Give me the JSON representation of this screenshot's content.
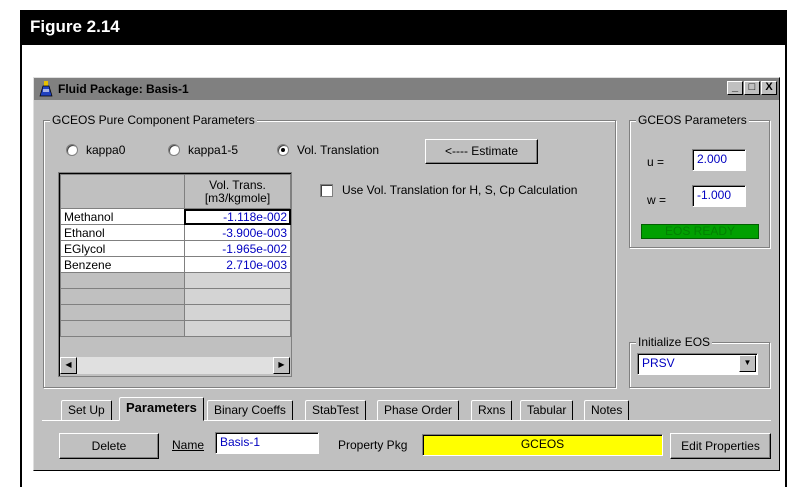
{
  "figure": {
    "label": "Figure 2.14"
  },
  "window": {
    "title": "Fluid Package: Basis-1",
    "controls": {
      "minimize": "_",
      "maximize": "□",
      "close": "X"
    }
  },
  "pure_component": {
    "group_title": "GCEOS Pure Component Parameters",
    "radio_options": [
      {
        "label": "kappa0",
        "selected": false
      },
      {
        "label": "kappa1-5",
        "selected": false
      },
      {
        "label": "Vol. Translation",
        "selected": true
      }
    ],
    "estimate_button": "<---- Estimate",
    "checkbox_label": "Use Vol. Translation for H, S, Cp Calculation",
    "checkbox_checked": false,
    "table": {
      "header_line1": "Vol. Trans.",
      "header_line2": "[m3/kgmole]",
      "rows": [
        {
          "name": "Methanol",
          "value": "-1.118e-002"
        },
        {
          "name": "Ethanol",
          "value": "-3.900e-003"
        },
        {
          "name": "EGlycol",
          "value": "-1.965e-002"
        },
        {
          "name": "Benzene",
          "value": "2.710e-003"
        }
      ]
    }
  },
  "gceos_params": {
    "group_title": "GCEOS Parameters",
    "u_label": "u =",
    "u_value": "2.000",
    "w_label": "w =",
    "w_value": "-1.000",
    "status": "EOS READY",
    "status_bg": "#00a000",
    "status_fg": "#008000"
  },
  "initialize_eos": {
    "group_title": "Initialize EOS",
    "selected": "PRSV"
  },
  "tabs": [
    {
      "label": "Set Up",
      "active": false
    },
    {
      "label": "Parameters",
      "active": true
    },
    {
      "label": "Binary Coeffs",
      "active": false
    },
    {
      "label": "StabTest",
      "active": false
    },
    {
      "label": "Phase Order",
      "active": false
    },
    {
      "label": "Rxns",
      "active": false
    },
    {
      "label": "Tabular",
      "active": false
    },
    {
      "label": "Notes",
      "active": false
    }
  ],
  "bottom_bar": {
    "delete_button": "Delete",
    "name_label": "Name",
    "name_value": "Basis-1",
    "property_pkg_label": "Property Pkg",
    "property_pkg_value": "GCEOS",
    "property_pkg_color": "#ffff00",
    "edit_properties_button": "Edit Properties"
  }
}
